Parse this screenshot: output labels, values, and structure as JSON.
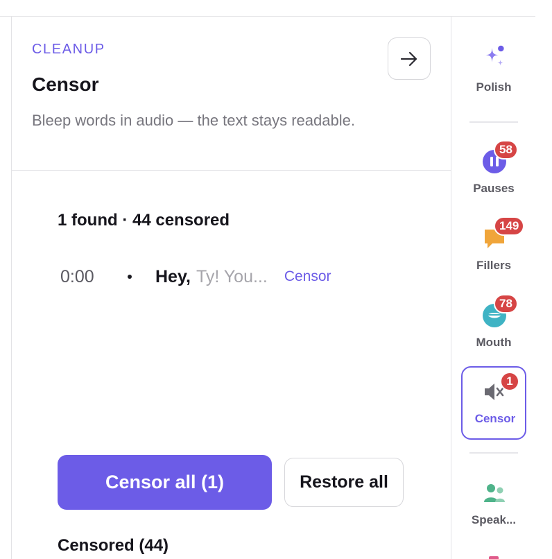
{
  "panel": {
    "eyebrow": "CLEANUP",
    "title": "Censor",
    "description": "Bleep words in audio — the text stays readable.",
    "summary": "1 found · 44 censored",
    "result": {
      "time": "0:00",
      "word": "Hey,",
      "context": "Ty! You...",
      "action": "Censor"
    },
    "primary_button": "Censor all (1)",
    "secondary_button": "Restore all",
    "section_title": "Censored (44)"
  },
  "rail": {
    "polish": {
      "label": "Polish",
      "icon": "sparkle-icon"
    },
    "pauses": {
      "label": "Pauses",
      "badge": "58",
      "icon": "pause-icon",
      "color": "#6c5ce7"
    },
    "fillers": {
      "label": "Fillers",
      "badge": "149",
      "icon": "speech-bubble-icon",
      "color": "#f0a53a"
    },
    "mouth": {
      "label": "Mouth",
      "badge": "78",
      "icon": "mouth-icon",
      "color": "#3fb3c4"
    },
    "censor": {
      "label": "Censor",
      "badge": "1",
      "icon": "mute-icon"
    },
    "speakers": {
      "label": "Speak...",
      "icon": "people-icon",
      "color": "#4fb38a"
    }
  },
  "colors": {
    "accent": "#6c5ce7",
    "badge": "#d64545"
  }
}
